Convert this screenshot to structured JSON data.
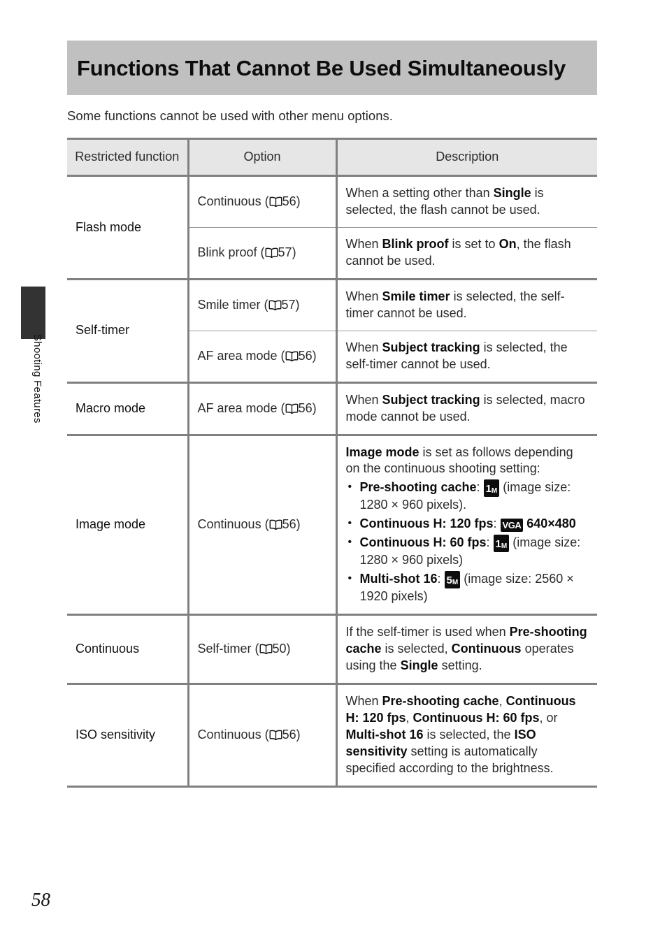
{
  "sidebar": {
    "section_label": "Shooting Features",
    "tab_color": "#333333"
  },
  "header": {
    "title": "Functions That Cannot Be Used Simultaneously",
    "band_color": "#c0c0c0"
  },
  "intro": "Some functions cannot be used with other menu options.",
  "table": {
    "columns": [
      "Restricted function",
      "Option",
      "Description"
    ],
    "rows": [
      {
        "function": "Flash mode",
        "entries": [
          {
            "option_text": "Continuous (",
            "option_page": "56)",
            "option_icon": "open-book-icon",
            "description_html": "When a setting other than <b>Single</b> is selected, the flash cannot be used."
          },
          {
            "option_text": "Blink proof (",
            "option_page": "57)",
            "option_icon": "open-book-icon",
            "description_html": "When <b>Blink proof</b> is set to <b>On</b>, the flash cannot be used."
          }
        ]
      },
      {
        "function": "Self-timer",
        "entries": [
          {
            "option_text": "Smile timer (",
            "option_page": "57)",
            "option_icon": "open-book-icon",
            "description_html": "When <b>Smile timer</b> is selected, the self-timer cannot be used."
          },
          {
            "option_text": "AF area mode (",
            "option_page": "56)",
            "option_icon": "open-book-icon",
            "description_html": "When <b>Subject tracking</b> is selected, the self-timer cannot be used."
          }
        ]
      },
      {
        "function": "Macro mode",
        "entries": [
          {
            "option_text": "AF area mode (",
            "option_page": "56)",
            "option_icon": "open-book-icon",
            "description_html": "When <b>Subject tracking</b> is selected, macro mode cannot be used."
          }
        ]
      },
      {
        "function": "Image mode",
        "entries": [
          {
            "option_text": "Continuous (",
            "option_page": "56)",
            "option_icon": "open-book-icon",
            "description_intro": "Image mode is set as follows depending on the continuous shooting setting:",
            "bullets": [
              {
                "label": "Pre-shooting cache",
                "badge": "1M",
                "badge_num": "1",
                "badge_unit": "M",
                "detail": " (image size: 1280 × 960 pixels)."
              },
              {
                "label": "Continuous H: 120 fps",
                "badge": "VGA",
                "detail_bold": "640×480"
              },
              {
                "label": "Continuous H: 60 fps",
                "badge": "1M",
                "badge_num": "1",
                "badge_unit": "M",
                "detail": " (image size: 1280 × 960 pixels)"
              },
              {
                "label": "Multi-shot 16",
                "badge": "5M",
                "badge_num": "5",
                "badge_unit": "M",
                "detail": " (image size: 2560 × 1920 pixels)"
              }
            ]
          }
        ]
      },
      {
        "function": "Continuous",
        "entries": [
          {
            "option_text": "Self-timer (",
            "option_page": "50)",
            "option_icon": "open-book-icon",
            "description_html": "If the self-timer is used when <b>Pre-shooting cache</b> is selected, <b>Continuous</b> operates using the <b>Single</b> setting."
          }
        ]
      },
      {
        "function": "ISO sensitivity",
        "entries": [
          {
            "option_text": "Continuous (",
            "option_page": "56)",
            "option_icon": "open-book-icon",
            "description_html": "When <b>Pre-shooting cache</b>, <b>Continuous H: 120 fps</b>, <b>Continuous H: 60 fps</b>, or <b>Multi-shot 16</b> is selected, the <b>ISO sensitivity</b> setting is automatically specified according to the brightness."
          }
        ]
      }
    ]
  },
  "footer": {
    "page_number": "58"
  }
}
